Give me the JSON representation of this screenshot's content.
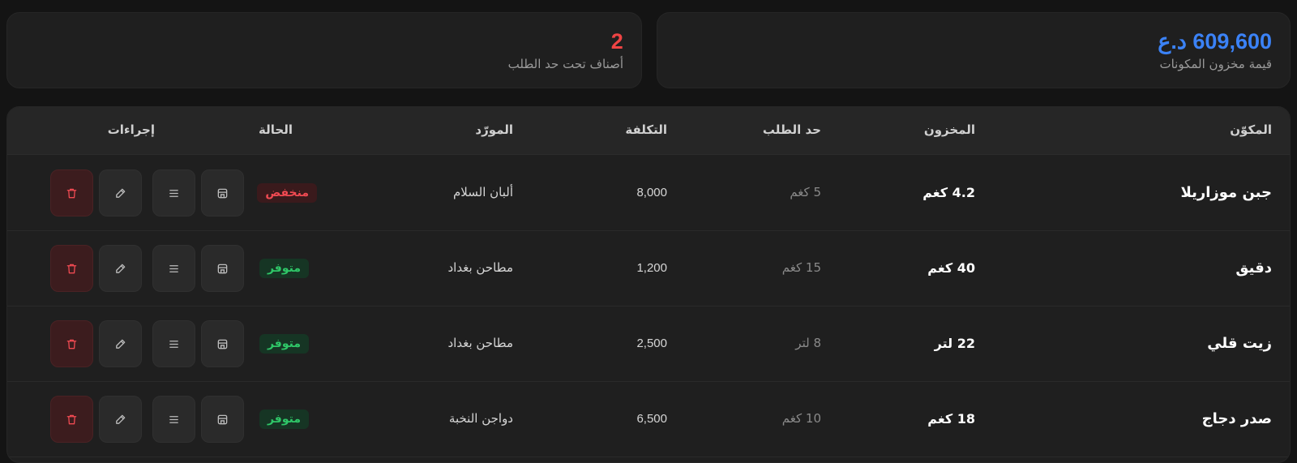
{
  "stats": {
    "inventory_value": {
      "value": "609,600 د.ع",
      "label": "قيمة مخزون المكونات",
      "color": "#3b82f6"
    },
    "below_reorder": {
      "value": "2",
      "label": "أصناف تحت حد الطلب",
      "color": "#ef4444"
    }
  },
  "table": {
    "headers": {
      "ingredient": "المكوّن",
      "stock": "المخزون",
      "reorder": "حد الطلب",
      "cost": "التكلفة",
      "supplier": "المورّد",
      "status": "الحالة",
      "actions": "إجراءات"
    },
    "rows": [
      {
        "name": "جبن موزاريلا",
        "stock": "4.2 كغم",
        "reorder": "5 كغم",
        "cost": "8,000",
        "supplier": "ألبان السلام",
        "status": "منخفض",
        "status_type": "low"
      },
      {
        "name": "دقيق",
        "stock": "40 كغم",
        "reorder": "15 كغم",
        "cost": "1,200",
        "supplier": "مطاحن بغداد",
        "status": "متوفر",
        "status_type": "ok"
      },
      {
        "name": "زيت قلي",
        "stock": "22 لتر",
        "reorder": "8 لتر",
        "cost": "2,500",
        "supplier": "مطاحن بغداد",
        "status": "متوفر",
        "status_type": "ok"
      },
      {
        "name": "صدر دجاج",
        "stock": "18 كغم",
        "reorder": "10 كغم",
        "cost": "6,500",
        "supplier": "دواجن النخبة",
        "status": "متوفر",
        "status_type": "ok"
      }
    ],
    "row_actions": [
      "store-icon",
      "list-icon",
      "edit-icon",
      "trash-icon"
    ]
  },
  "colors": {
    "accent_blue": "#3b82f6",
    "danger_red": "#ef4444",
    "success_green": "#22c55e",
    "background": "#141414",
    "card": "#1f1f1f"
  }
}
